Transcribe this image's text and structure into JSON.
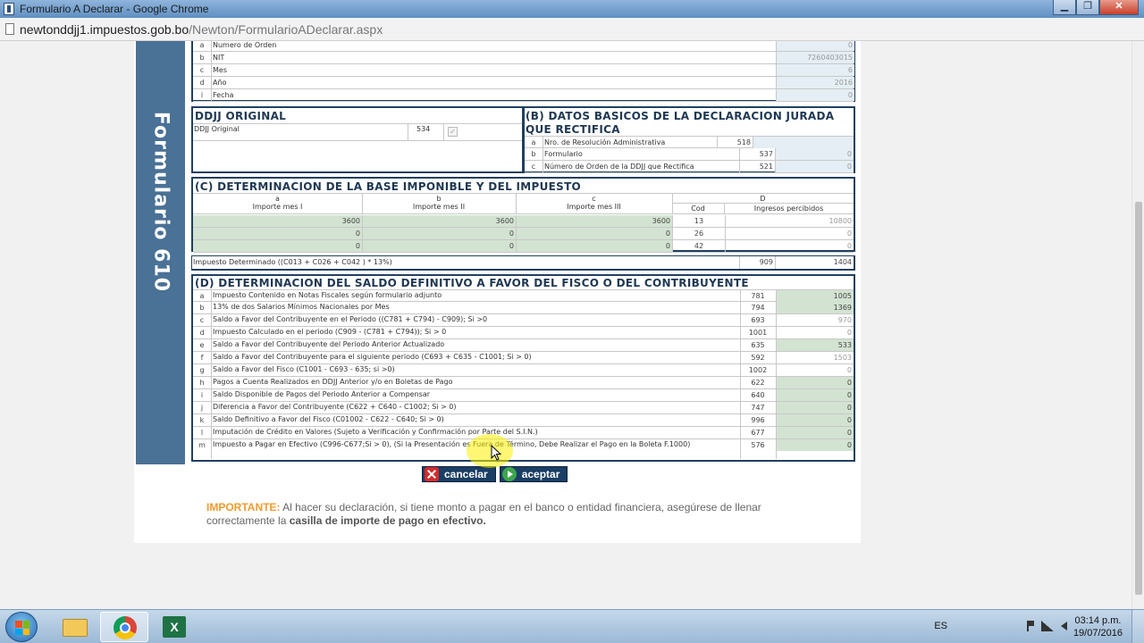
{
  "window": {
    "title": "Formulario A Declarar - Google Chrome",
    "url_host": "newtonddjj1.impuestos.gob.bo",
    "url_path": "/Newton/FormularioADeclarar.aspx",
    "minimize": "▁",
    "maximize": "❐",
    "close": "✕"
  },
  "sidebar": {
    "label": "Formulario 610"
  },
  "header_rows": [
    {
      "letter": "a",
      "label": "Numero de Orden",
      "value": "0"
    },
    {
      "letter": "b",
      "label": "NIT",
      "value": "7260403015"
    },
    {
      "letter": "c",
      "label": "Mes",
      "value": "6"
    },
    {
      "letter": "d",
      "label": "Año",
      "value": "2016"
    },
    {
      "letter": "i",
      "label": "Fecha",
      "value": "0"
    }
  ],
  "ddjj_original": {
    "title": "DDJJ ORIGINAL",
    "label": "DDJJ Original",
    "code": "534",
    "check": "✓"
  },
  "section_b": {
    "title": "(B) DATOS BASICOS DE LA DECLARACION JURADA QUE RECTIFICA",
    "rows": [
      {
        "letter": "a",
        "label": "Nro. de Resolución Administrativa",
        "code": "518",
        "value": ""
      },
      {
        "letter": "b",
        "label": "Formulario",
        "code": "537",
        "value": "0"
      },
      {
        "letter": "c",
        "label": "Número de Orden de la DDJJ que Rectifica",
        "code": "521",
        "value": "0"
      }
    ]
  },
  "section_c": {
    "title": "(C) DETERMINACION DE LA BASE IMPONIBLE Y DEL IMPUESTO",
    "col_a_letter": "a",
    "col_a": "Importe mes I",
    "col_b_letter": "b",
    "col_b": "Importe mes II",
    "col_c_letter": "c",
    "col_c": "Importe mes III",
    "col_d_letter": "D",
    "col_cod": "Cod",
    "col_ing": "Ingresos percibidos",
    "rows": [
      {
        "a": "3600",
        "b": "3600",
        "c": "3600",
        "cod": "13",
        "ing": "10800"
      },
      {
        "a": "0",
        "b": "0",
        "c": "0",
        "cod": "26",
        "ing": "0"
      },
      {
        "a": "0",
        "b": "0",
        "c": "0",
        "cod": "42",
        "ing": "0"
      }
    ],
    "impuesto_label": "Impuesto Determinado ((C013 + C026 + C042 ) * 13%)",
    "impuesto_code": "909",
    "impuesto_value": "1404"
  },
  "section_d": {
    "title": "(D) DETERMINACION DEL SALDO DEFINITIVO A FAVOR DEL FISCO O DEL CONTRIBUYENTE",
    "rows": [
      {
        "letter": "a",
        "label": "Impuesto Contenido en Notas Fiscales según formulario adjunto",
        "code": "781",
        "value": "1005",
        "editable": true
      },
      {
        "letter": "b",
        "label": "13% de dos Salarios Mínimos Nacionales por Mes",
        "code": "794",
        "value": "1369",
        "editable": true
      },
      {
        "letter": "c",
        "label": "Saldo a Favor del Contribuyente en el Periodo ((C781 + C794) - C909); Si >0",
        "code": "693",
        "value": "970",
        "editable": false
      },
      {
        "letter": "d",
        "label": "Impuesto Calculado en el periodo (C909 - (C781 + C794)); Si > 0",
        "code": "1001",
        "value": "0",
        "editable": false
      },
      {
        "letter": "e",
        "label": "Saldo a Favor del Contribuyente del Periodo Anterior Actualizado",
        "code": "635",
        "value": "533",
        "editable": true
      },
      {
        "letter": "f",
        "label": "Saldo a Favor del Contribuyente para el siguiente periodo (C693 + C635 - C1001; Si > 0)",
        "code": "592",
        "value": "1503",
        "editable": false
      },
      {
        "letter": "g",
        "label": "Saldo a Favor del Fisco (C1001 - C693 - 635; si >0)",
        "code": "1002",
        "value": "0",
        "editable": false
      },
      {
        "letter": "h",
        "label": "Pagos a Cuenta Realizados en DDJJ Anterior y/o en Boletas de Pago",
        "code": "622",
        "value": "0",
        "editable": true
      },
      {
        "letter": "i",
        "label": "Saldo Disponible de Pagos del Periodo Anterior a Compensar",
        "code": "640",
        "value": "0",
        "editable": true
      },
      {
        "letter": "j",
        "label": "Diferencia a Favor del Contribuyente (C622 + C640 - C1002; Si > 0)",
        "code": "747",
        "value": "0",
        "editable": true
      },
      {
        "letter": "k",
        "label": "Saldo Definitivo a Favor del Fisco (C01002 - C622 - C640; Si > 0)",
        "code": "996",
        "value": "0",
        "editable": true
      },
      {
        "letter": "l",
        "label": "Imputación de Crédito en Valores (Sujeto a Verificación y Confirmación por Parte del S.I.N.)",
        "code": "677",
        "value": "0",
        "editable": true
      },
      {
        "letter": "m",
        "label": "Impuesto a Pagar en Efectivo (C996-C677;Si > 0), (Si la Presentación es Fuera de Término, Debe Realizar el Pago en la Boleta F.1000)",
        "code": "576",
        "value": "0",
        "editable": true
      }
    ]
  },
  "buttons": {
    "cancel": "cancelar",
    "accept": "aceptar"
  },
  "notice": {
    "label": "IMPORTANTE:",
    "text1": " Al hacer su declaración, si tiene monto a pagar en el banco o entidad financiera, asegúrese de llenar correctamente la ",
    "emph": "casilla de importe de pago en efectivo."
  },
  "taskbar": {
    "lang": "ES",
    "time": "03:14 p.m.",
    "date": "19/07/2016"
  },
  "colors": {
    "sidebar": "#4a7196",
    "border": "#20405f",
    "green_cell": "#d3e3d2",
    "important": "#f29a2e"
  }
}
